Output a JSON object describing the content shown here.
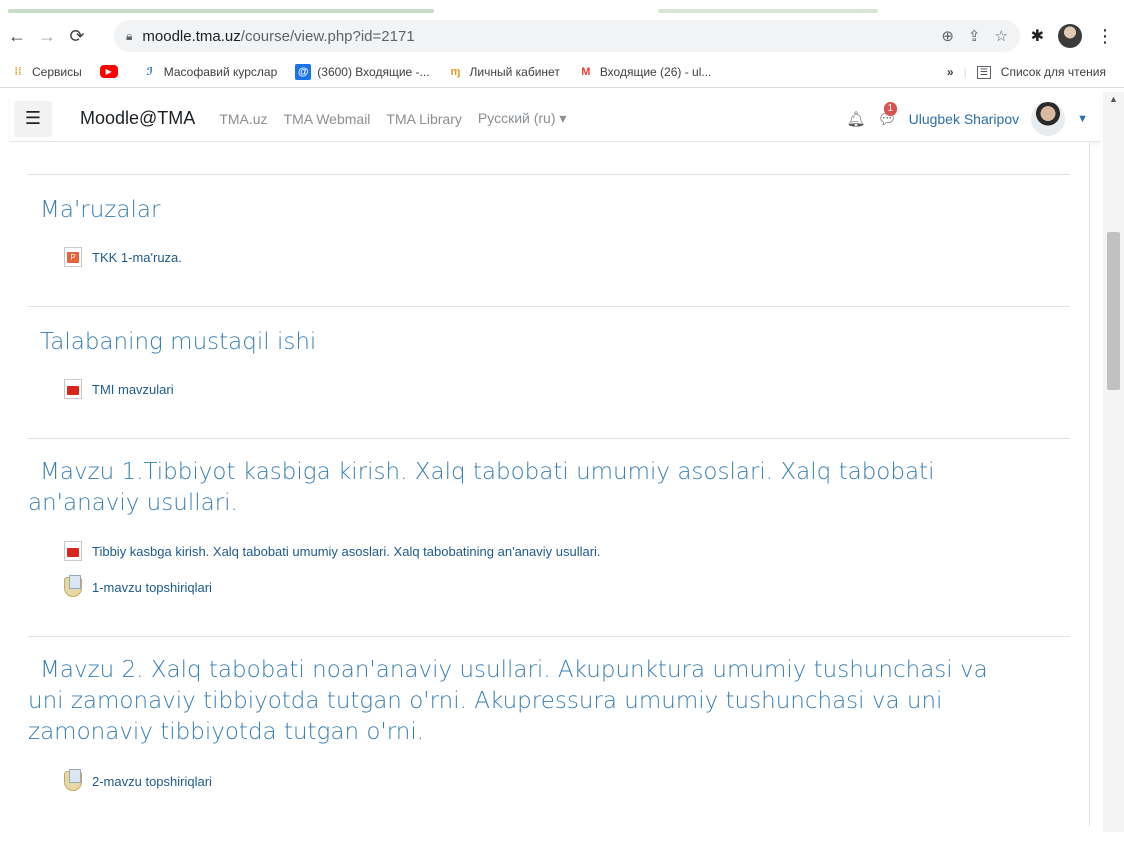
{
  "browser": {
    "url_host": "moodle.tma.uz",
    "url_path": "/course/view.php?id=2171",
    "bookmarks": [
      {
        "label": "Сервисы",
        "icon": "apps-grid-icon",
        "color": "#e8a33d"
      },
      {
        "label": "",
        "icon": "youtube-icon",
        "color": "#ff0000"
      },
      {
        "label": "Масофавий курслар",
        "icon": "course-icon",
        "color": "#2a73c8"
      },
      {
        "label": "(3600) Входящие -...",
        "icon": "mail-icon",
        "color": "#1a73e8"
      },
      {
        "label": "Личный кабинет",
        "icon": "cabinet-icon",
        "color": "#e8962a"
      },
      {
        "label": "Входящие (26) - ul...",
        "icon": "gmail-icon",
        "color": "#ea4335"
      }
    ],
    "more_bookmarks": "»",
    "reading_list": "Список для чтения"
  },
  "moodle": {
    "brand": "Moodle@TMA",
    "links": [
      "TMA.uz",
      "TMA Webmail",
      "TMA Library",
      "Русский (ru)"
    ],
    "language_caret": "▾",
    "notifications_badge": "1",
    "user_name": "Ulugbek Sharipov",
    "accent_color": "#3a7fb2"
  },
  "sections": [
    {
      "title": "Ma'ruzalar",
      "activities": [
        {
          "type": "powerpoint",
          "icon": "ppt-file-icon",
          "label": "TKK 1-ma'ruza."
        }
      ]
    },
    {
      "title": "Talabaning mustaqil ishi",
      "activities": [
        {
          "type": "pdf",
          "icon": "pdf-file-icon",
          "label": "TMI mavzulari"
        }
      ]
    },
    {
      "title": "Mavzu 1.Tibbiyot kasbiga kirish. Xalq tabobati umumiy asoslari. Xalq tabobati an'anaviy usullari.",
      "activities": [
        {
          "type": "pdf",
          "icon": "pdf-file-icon",
          "label": "Tibbiy kasbga kirish. Xalq tabobati umumiy asoslari. Xalq tabobatining an'anaviy usullari."
        },
        {
          "type": "assignment",
          "icon": "assignment-icon",
          "label": "1-mavzu topshiriqlari"
        }
      ]
    },
    {
      "title": "Mavzu 2. Xalq tabobati noan'anaviy usullari. Akupunktura umumiy tushunchasi va uni zamonaviy tibbiyotda tutgan o'rni. Akupressura umumiy tushunchasi va uni zamonaviy tibbiyotda tutgan o'rni.",
      "activities": [
        {
          "type": "assignment",
          "icon": "assignment-icon",
          "label": "2-mavzu topshiriqlari"
        }
      ]
    }
  ]
}
